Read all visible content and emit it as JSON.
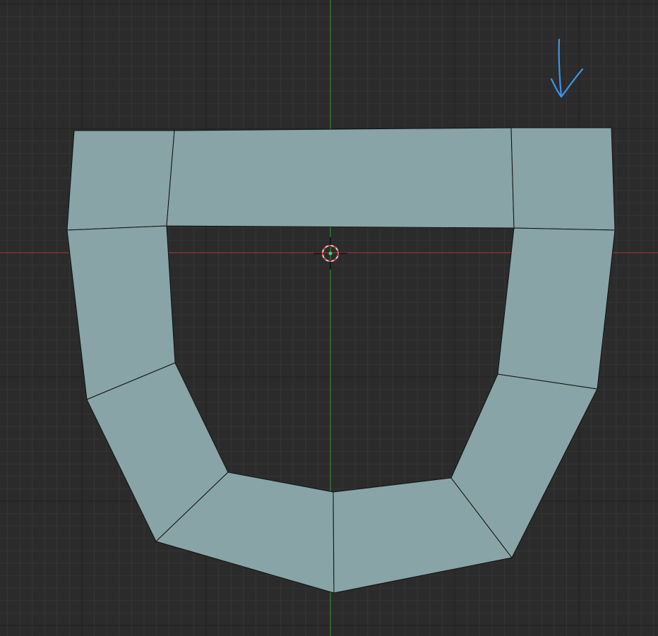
{
  "viewport": {
    "background_color": "#2b2b2b",
    "minor_grid_color": "#353535",
    "major_grid_color": "#202020",
    "x_axis_color": "#a83a3a",
    "y_axis_color": "#2f9a3a",
    "face_color": "#88a4a6",
    "edge_color": "#111111",
    "annotation_color": "#3a95e8"
  },
  "cursor_3d": {
    "icon": "3d-cursor-icon",
    "ring_colors": [
      "#d8d8d8",
      "#d33a3a"
    ]
  },
  "origin": {
    "icon": "object-origin-icon",
    "color": "#3fd36a"
  },
  "annotation": {
    "icon": "arrow-down-icon",
    "style": "hand-drawn"
  },
  "mesh": {
    "shape": "U-shaped ring of quad faces",
    "face_count": 9
  }
}
